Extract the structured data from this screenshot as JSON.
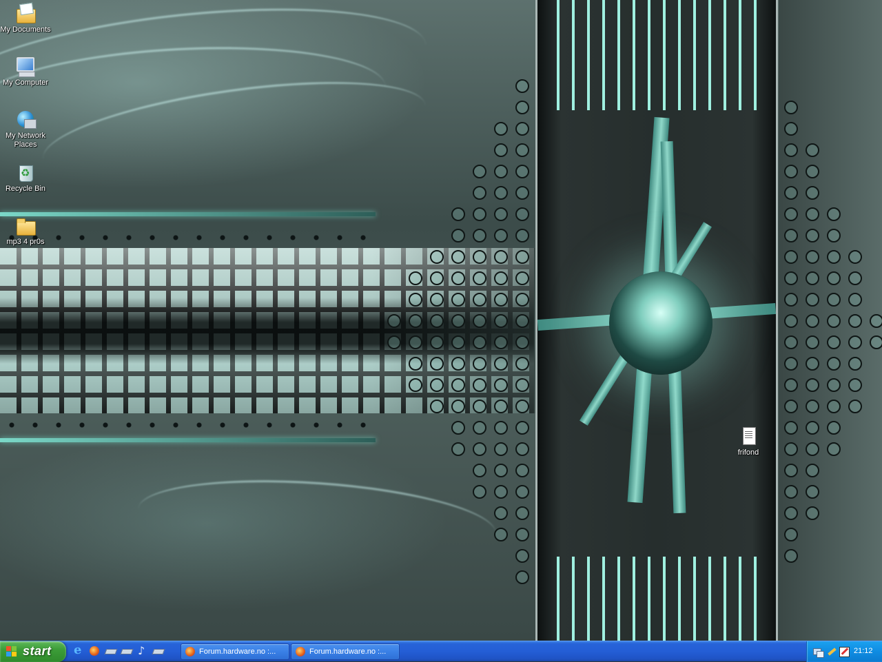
{
  "desktop": {
    "icons": [
      {
        "label": "My Documents",
        "icon": "my-documents-icon"
      },
      {
        "label": "My Computer",
        "icon": "my-computer-icon"
      },
      {
        "label": "My Network Places",
        "icon": "my-network-places-icon"
      },
      {
        "label": "Recycle Bin",
        "icon": "recycle-bin-icon"
      },
      {
        "label": "mp3 4 pr0s",
        "icon": "folder-icon"
      },
      {
        "label": "frifond",
        "icon": "text-document-icon"
      }
    ]
  },
  "taskbar": {
    "start_label": "start",
    "quick_launch": [
      "internet-explorer-icon",
      "firefox-icon",
      "show-desktop-icon",
      "app-icon",
      "music-player-icon",
      "app-icon"
    ],
    "tasks": [
      {
        "label": "Forum.hardware.no :...",
        "icon": "firefox-icon"
      },
      {
        "label": "Forum.hardware.no :...",
        "icon": "firefox-icon"
      }
    ],
    "tray": {
      "icons": [
        "network-icon",
        "pen-icon",
        "edit-icon"
      ],
      "clock": "21:12"
    }
  },
  "colors": {
    "taskbar_blue": "#245ed6",
    "start_green": "#3c9d38",
    "tray_blue": "#0f8ce2",
    "wallpaper_teal": "#7bd8c8"
  }
}
